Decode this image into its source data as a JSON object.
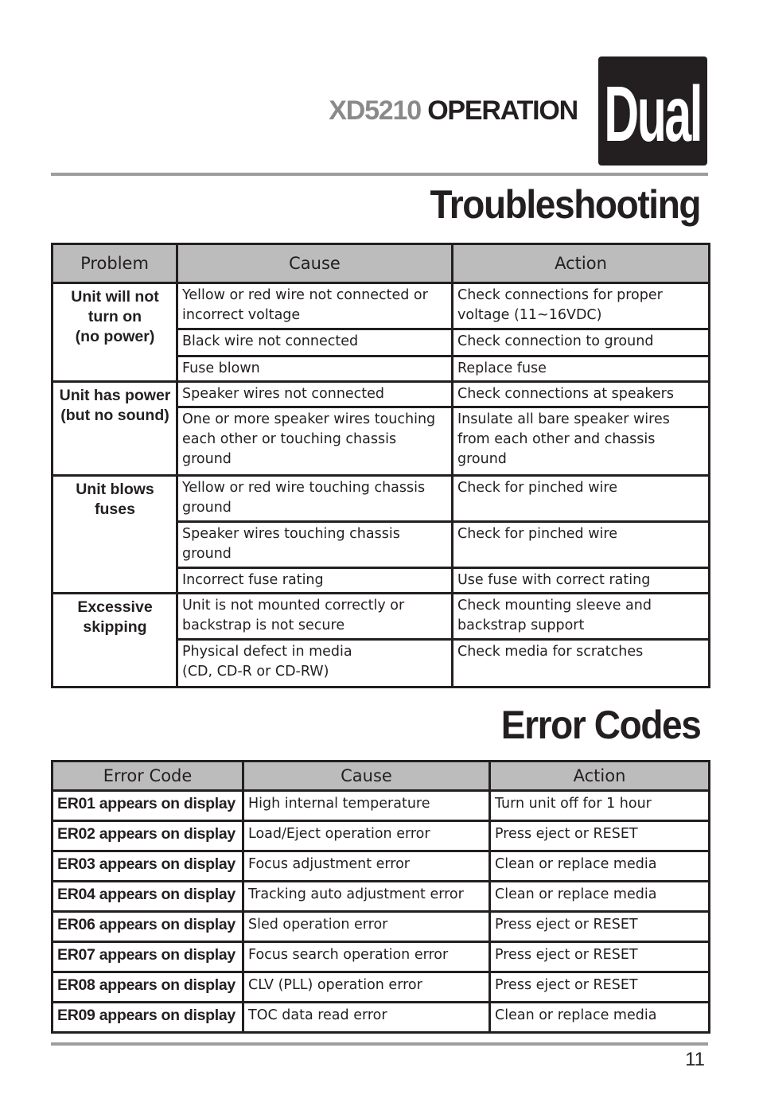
{
  "header": {
    "model": "XD5210",
    "section": "OPERATION",
    "logo_text": "Dual"
  },
  "troubleshooting": {
    "title": "Troubleshooting",
    "columns": [
      "Problem",
      "Cause",
      "Action"
    ],
    "groups": [
      {
        "problem": [
          "Unit will not",
          "turn on",
          "(no power)"
        ],
        "rows": [
          {
            "cause": "Yellow or red wire not connected or incorrect voltage",
            "action": "Check connections for proper voltage (11~16VDC)"
          },
          {
            "cause": "Black wire not connected",
            "action": "Check connection to ground"
          },
          {
            "cause": "Fuse blown",
            "action": "Replace fuse"
          }
        ]
      },
      {
        "problem": [
          "Unit has power",
          "(but no sound)"
        ],
        "rows": [
          {
            "cause": "Speaker wires not connected",
            "action": "Check connections at speakers"
          },
          {
            "cause": "One or more speaker wires touching each other or touching chassis ground",
            "action": "Insulate all bare speaker wires from each other and chassis ground"
          }
        ]
      },
      {
        "problem": [
          "Unit blows",
          "fuses"
        ],
        "rows": [
          {
            "cause": "Yellow or red wire touching chassis ground",
            "action": "Check for pinched wire"
          },
          {
            "cause": "Speaker wires touching chassis ground",
            "action": "Check for pinched wire"
          },
          {
            "cause": "Incorrect fuse rating",
            "action": "Use fuse with correct rating"
          }
        ]
      },
      {
        "problem": [
          "Excessive",
          "skipping"
        ],
        "rows": [
          {
            "cause": "Unit is not mounted correctly or backstrap is not secure",
            "action": "Check mounting sleeve and backstrap support"
          },
          {
            "cause": "Physical defect in media\n(CD, CD-R or CD-RW)",
            "action": "Check media for scratches"
          }
        ]
      }
    ]
  },
  "error_codes": {
    "title": "Error Codes",
    "columns": [
      "Error Code",
      "Cause",
      "Action"
    ],
    "rows": [
      {
        "code": "ER01 appears on display",
        "cause": "High internal temperature",
        "action": "Turn unit off for 1 hour"
      },
      {
        "code": "ER02 appears on display",
        "cause": "Load/Eject operation error",
        "action": "Press eject or RESET"
      },
      {
        "code": "ER03 appears on display",
        "cause": "Focus adjustment error",
        "action": "Clean or replace media"
      },
      {
        "code": "ER04 appears on display",
        "cause": "Tracking auto adjustment error",
        "action": "Clean or replace media"
      },
      {
        "code": "ER06 appears on display",
        "cause": "Sled operation error",
        "action": "Press eject or RESET"
      },
      {
        "code": "ER07 appears on display",
        "cause": "Focus search operation error",
        "action": "Press eject or RESET"
      },
      {
        "code": "ER08 appears on display",
        "cause": "CLV (PLL) operation error",
        "action": "Press eject or RESET"
      },
      {
        "code": "ER09 appears on display",
        "cause": "TOC data read error",
        "action": "Clean or replace media"
      }
    ]
  },
  "footer": {
    "page_number": "11"
  }
}
